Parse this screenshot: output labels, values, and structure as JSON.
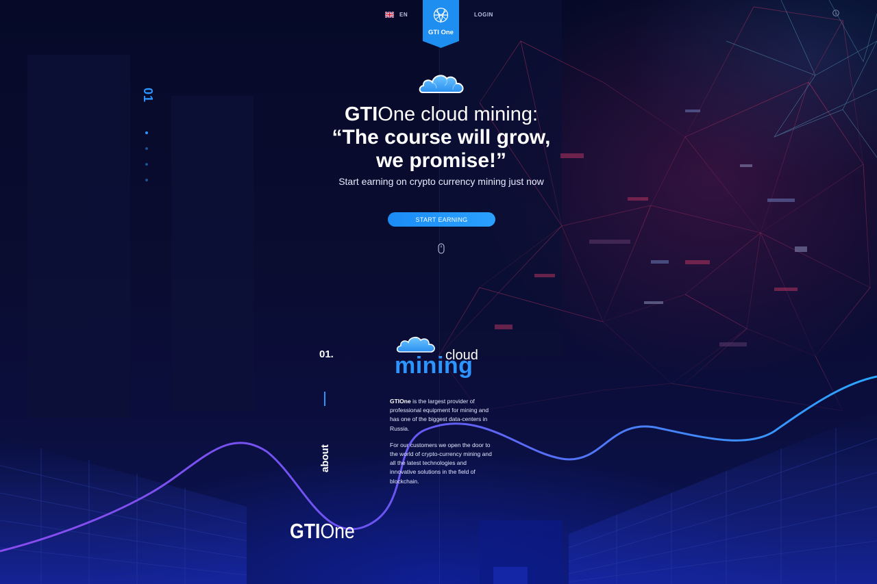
{
  "header": {
    "language": "EN",
    "logo_text": "GTI One",
    "login_label": "LOGIN"
  },
  "slider": {
    "current_number": "01",
    "dot_count": 4,
    "active_dot": 1
  },
  "hero": {
    "brand_gti": "GTI",
    "brand_one": "One",
    "title_rest": " cloud mining:",
    "title_line2": "“The course will grow,",
    "title_line3": "we promise!”",
    "subtitle": "Start earning on crypto currency mining just now",
    "cta_label": "START EARNING"
  },
  "about": {
    "section_number": "01.",
    "section_label": "about",
    "logo_word_small": "cloud",
    "logo_word_large": "mining",
    "paragraph1_brand": "GTIOne",
    "paragraph1_rest": " is the largest provider of professional equipment for mining and has one of the biggest data-centers in Russia.",
    "paragraph2": "For our customers we open the door to the world of crypto-currency mining and all the latest technologies and innovative solutions in the field of blockchain."
  },
  "footer": {
    "logo_gti": "GTI",
    "logo_one": "One"
  },
  "colors": {
    "accent": "#2d95ff",
    "background": "#080a26",
    "wave_start": "#7d4cf0",
    "wave_end": "#2aa7ff",
    "network_lines": "#b1335e"
  },
  "icons": {
    "flag": "uk-flag-icon",
    "logo": "gti-globe-icon",
    "info": "info-icon",
    "hero_cloud": "cloud-icon",
    "scroll": "mouse-scroll-icon"
  }
}
